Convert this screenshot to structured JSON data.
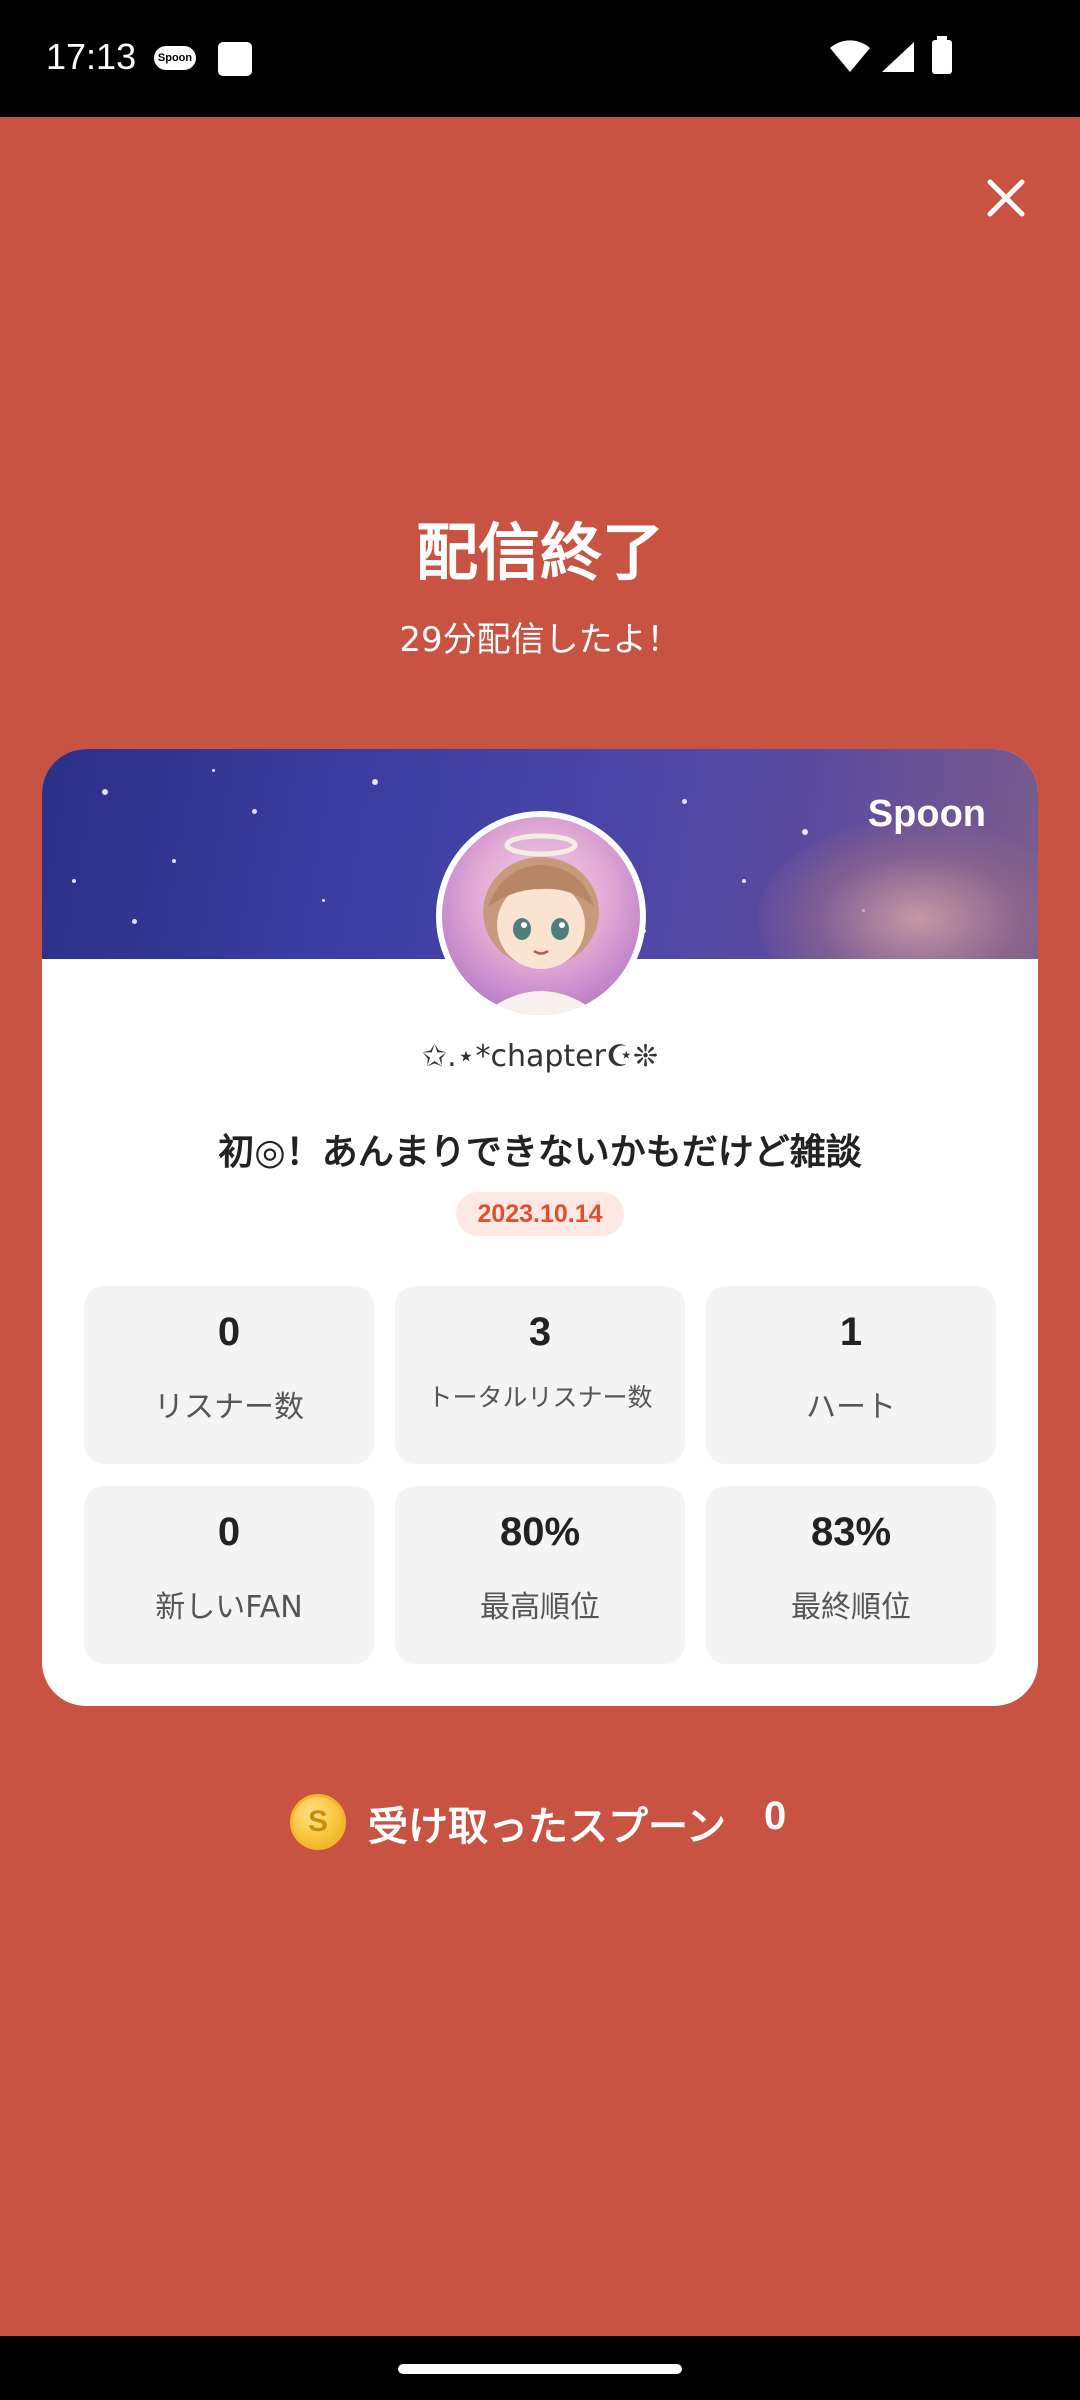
{
  "status_bar": {
    "time": "17:13",
    "app_badge": "Spoon",
    "icons": [
      "spoon-notification-icon",
      "square-notification-icon",
      "wifi-icon",
      "signal-icon",
      "battery-icon"
    ]
  },
  "header": {
    "title": "配信終了",
    "subtitle": "29分配信したよ！"
  },
  "card": {
    "brand": "Spoon",
    "nickname": "✩.⋆*chapter☪︎❊",
    "live_title": "初◎！あんまりできないかもだけど雑談",
    "date": "2023.10.14",
    "stats": [
      {
        "value": "0",
        "label": "リスナー数"
      },
      {
        "value": "3",
        "label": "トータルリスナー数"
      },
      {
        "value": "1",
        "label": "ハート"
      },
      {
        "value": "0",
        "label": "新しいFAN"
      },
      {
        "value": "80%",
        "label": "最高順位"
      },
      {
        "value": "83%",
        "label": "最終順位"
      }
    ]
  },
  "spoons": {
    "coin_letter": "S",
    "label": "受け取ったスプーン",
    "count": "0"
  },
  "colors": {
    "background": "#c85342",
    "card": "#ffffff",
    "stat_bg": "#f4f4f4",
    "date_text": "#e0502f",
    "date_bg": "#fde8e3"
  }
}
